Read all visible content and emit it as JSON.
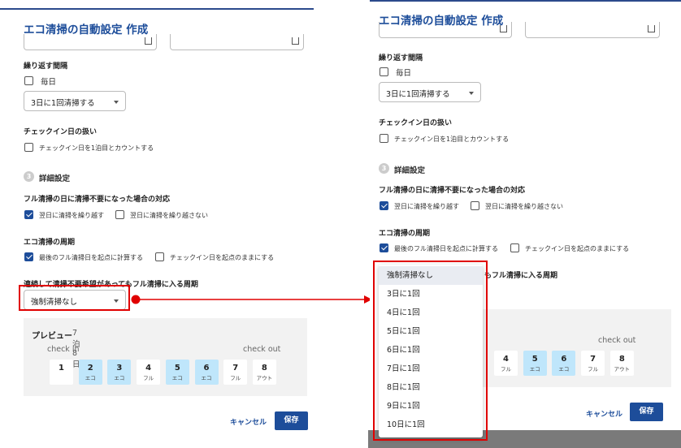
{
  "dialog_title": "エコ清掃の自動設定 作成",
  "repeat_interval": {
    "label": "繰り返す間隔",
    "daily_label": "毎日",
    "select_value": "3日に1回清掃する"
  },
  "checkin_day": {
    "label": "チェックイン日の扱い",
    "option_label": "チェックイン日を1泊目とカウントする"
  },
  "advanced": {
    "step_number": "3",
    "title": "詳細設定",
    "full_clean_label": "フル清掃の日に清掃不要になった場合の対応",
    "opt_carry_over": "翌日に清掃を繰り越す",
    "opt_no_carry_over": "翌日に清掃を繰り越さない",
    "eco_cycle_label": "エコ清掃の周期",
    "opt_from_last_full": "最後のフル清掃日を起点に計算する",
    "opt_keep_checkin": "チェックイン日を起点のままにする",
    "forced_cycle_label": "連続して清掃不要希望があってもフル清掃に入る周期",
    "forced_cycle_value": "強制清掃なし",
    "forced_cycle_label_partial": "もフル清掃に入る周期"
  },
  "preview": {
    "title": "プレビュー",
    "subtitle": "7泊8日",
    "check_in": "check in",
    "check_out": "check out",
    "days": [
      {
        "num": "1",
        "sub": "",
        "highlight": false
      },
      {
        "num": "2",
        "sub": "エコ",
        "highlight": true
      },
      {
        "num": "3",
        "sub": "エコ",
        "highlight": true
      },
      {
        "num": "4",
        "sub": "フル",
        "highlight": false
      },
      {
        "num": "5",
        "sub": "エコ",
        "highlight": true
      },
      {
        "num": "6",
        "sub": "エコ",
        "highlight": true
      },
      {
        "num": "7",
        "sub": "フル",
        "highlight": false
      },
      {
        "num": "8",
        "sub": "アウト",
        "highlight": false
      }
    ]
  },
  "actions": {
    "cancel": "キャンセル",
    "save": "保存"
  },
  "dropdown_options": [
    "強制清掃なし",
    "3日に1回",
    "4日に1回",
    "5日に1回",
    "6日に1回",
    "7日に1回",
    "8日に1回",
    "9日に1回",
    "10日に1回"
  ],
  "dropdown_selected_index": 0,
  "colors": {
    "primary": "#1d4d9a",
    "highlight_day": "#bfe6fb",
    "annotation_red": "#e00000"
  }
}
